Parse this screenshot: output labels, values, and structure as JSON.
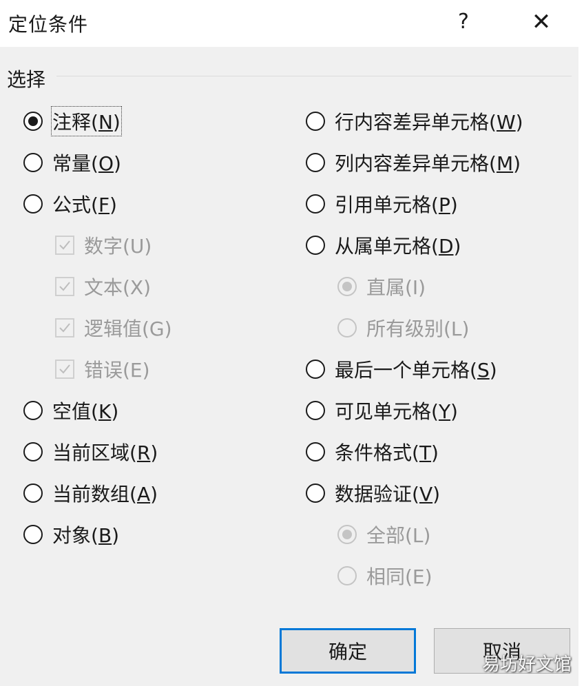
{
  "dialog": {
    "title": "定位条件",
    "help": "?",
    "close": "✕"
  },
  "group": {
    "label": "选择"
  },
  "left": [
    {
      "key": "comments",
      "text": "注释(",
      "mn": "N",
      "end": ")",
      "checked": true
    },
    {
      "key": "constants",
      "text": "常量(",
      "mn": "O",
      "end": ")",
      "checked": false
    },
    {
      "key": "formulas",
      "text": "公式(",
      "mn": "F",
      "end": ")",
      "checked": false
    }
  ],
  "formula_types": [
    {
      "key": "numbers",
      "text": "数字(U)",
      "checked": true
    },
    {
      "key": "text",
      "text": "文本(X)",
      "checked": true
    },
    {
      "key": "logicals",
      "text": "逻辑值(G)",
      "checked": true
    },
    {
      "key": "errors",
      "text": "错误(E)",
      "checked": true
    }
  ],
  "left2": [
    {
      "key": "blanks",
      "text": "空值(",
      "mn": "K",
      "end": ")",
      "checked": false
    },
    {
      "key": "current_region",
      "text": "当前区域(",
      "mn": "R",
      "end": ")",
      "checked": false
    },
    {
      "key": "current_array",
      "text": "当前数组(",
      "mn": "A",
      "end": ")",
      "checked": false
    },
    {
      "key": "objects",
      "text": "对象(",
      "mn": "B",
      "end": ")",
      "checked": false
    }
  ],
  "right": [
    {
      "key": "row_diff",
      "text": "行内容差异单元格(",
      "mn": "W",
      "end": ")",
      "checked": false
    },
    {
      "key": "col_diff",
      "text": "列内容差异单元格(",
      "mn": "M",
      "end": ")",
      "checked": false
    },
    {
      "key": "precedents",
      "text": "引用单元格(",
      "mn": "P",
      "end": ")",
      "checked": false
    },
    {
      "key": "dependents",
      "text": "从属单元格(",
      "mn": "D",
      "end": ")",
      "checked": false
    }
  ],
  "dependents_sub": [
    {
      "key": "direct_only",
      "text": "直属(I)",
      "checked": true
    },
    {
      "key": "all_levels",
      "text": "所有级别(L)",
      "checked": false
    }
  ],
  "right2": [
    {
      "key": "last_cell",
      "text": "最后一个单元格(",
      "mn": "S",
      "end": ")",
      "checked": false
    },
    {
      "key": "visible_cells",
      "text": "可见单元格(",
      "mn": "Y",
      "end": ")",
      "checked": false
    },
    {
      "key": "conditional_formats",
      "text": "条件格式(",
      "mn": "T",
      "end": ")",
      "checked": false
    },
    {
      "key": "data_validation",
      "text": "数据验证(",
      "mn": "V",
      "end": ")",
      "checked": false
    }
  ],
  "validation_sub": [
    {
      "key": "all",
      "text": "全部(L)",
      "checked": true
    },
    {
      "key": "same",
      "text": "相同(E)",
      "checked": false
    }
  ],
  "buttons": {
    "ok": "确定",
    "cancel": "取消"
  },
  "watermark": "易坊好文馆",
  "colors": {
    "accent": "#0078d7",
    "client_bg": "#f0f0f0",
    "disabled": "#9a9a9a"
  }
}
